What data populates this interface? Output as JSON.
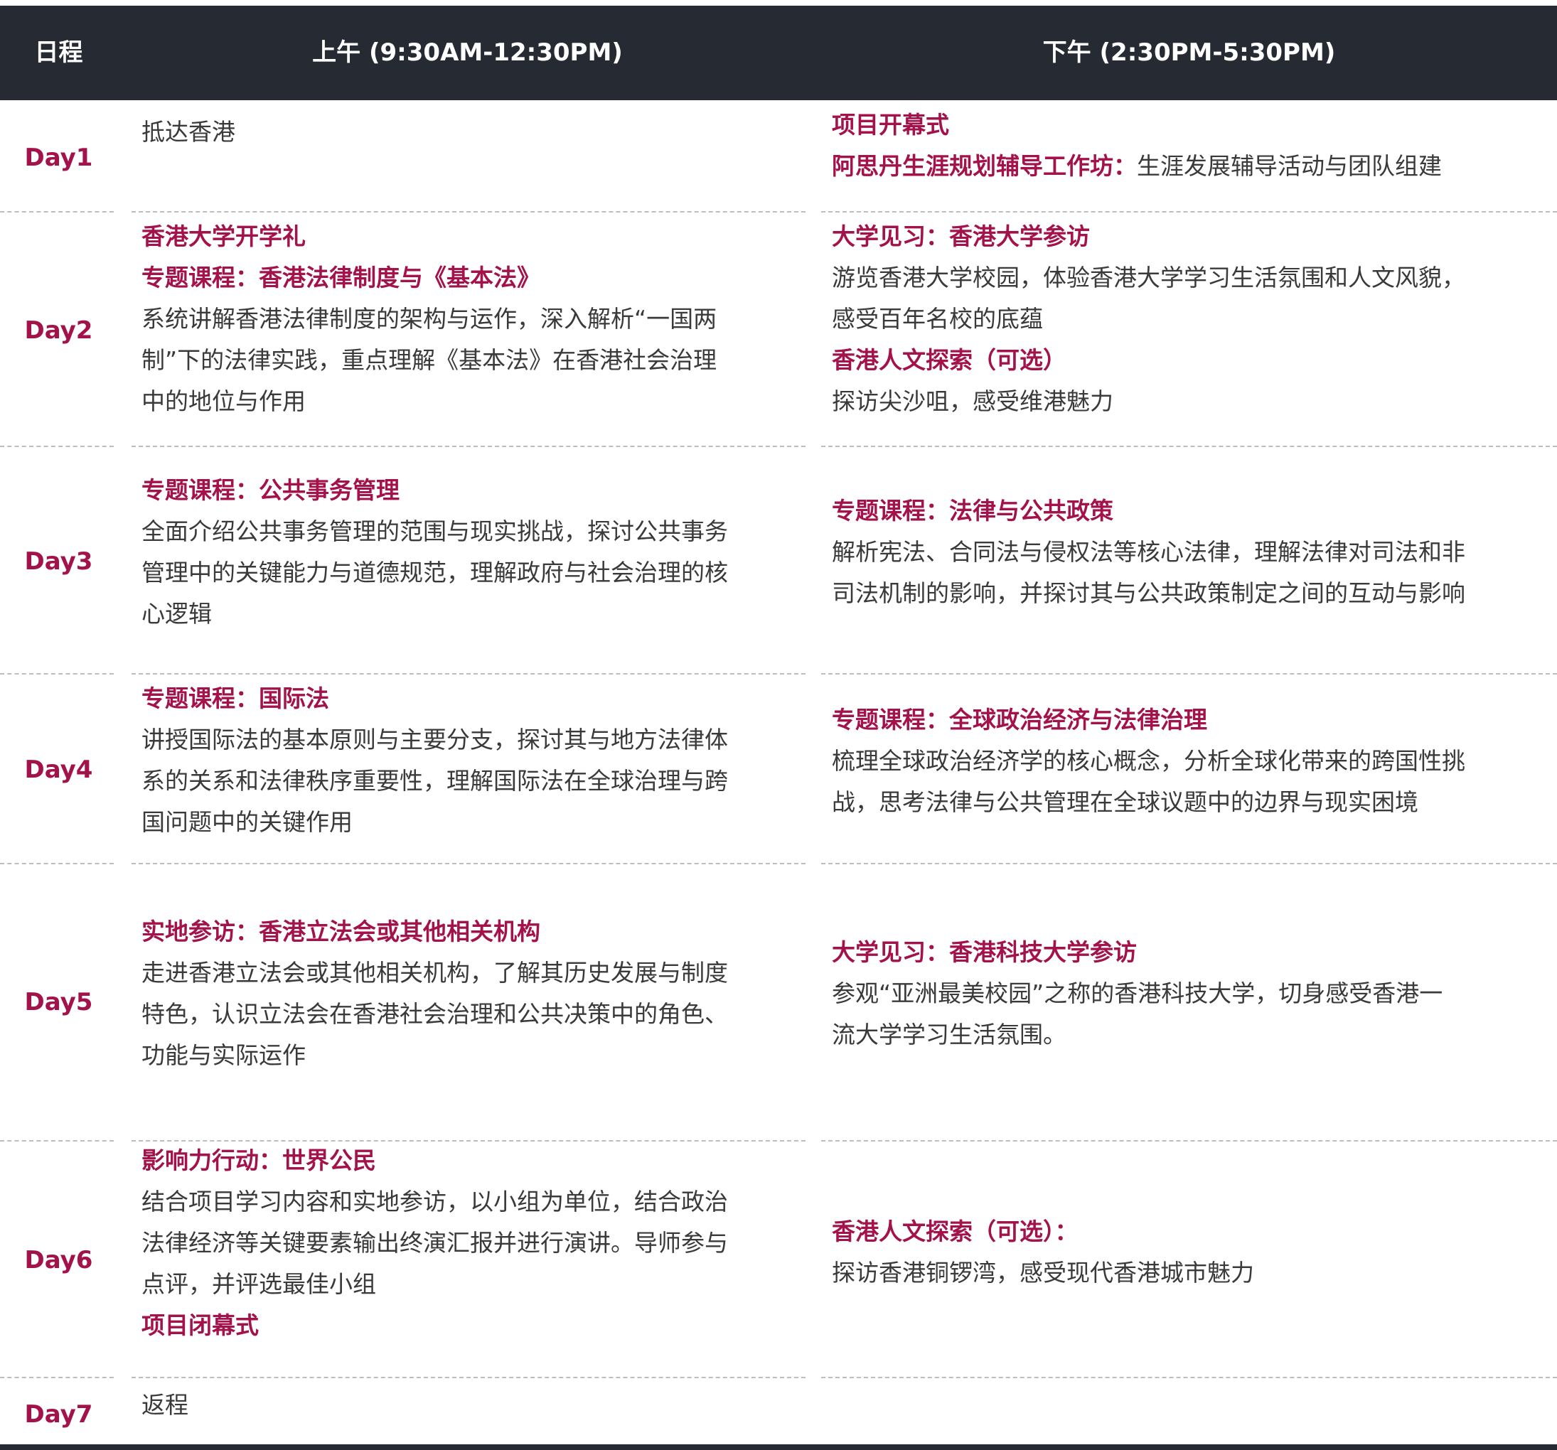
{
  "header": {
    "day": "日程",
    "am": "上午 (9:30AM-12:30PM)",
    "pm": "下午 (2:30PM-5:30PM)"
  },
  "days": [
    {
      "label": "Day1",
      "am": [
        {
          "t": "抵达香港",
          "h": false
        }
      ],
      "pm": [
        {
          "t": "项目开幕式",
          "h": true
        },
        {
          "t": "阿思丹生涯规划辅导工作坊：",
          "h": true,
          "rest": "生涯发展辅导活动与团队组建"
        }
      ]
    },
    {
      "label": "Day2",
      "am": [
        {
          "t": "香港大学开学礼",
          "h": true
        },
        {
          "t": "专题课程：香港法律制度与《基本法》",
          "h": true
        },
        {
          "t": "系统讲解香港法律制度的架构与运作，深入解析“一国两",
          "h": false
        },
        {
          "t": "制”下的法律实践，重点理解《基本法》在香港社会治理",
          "h": false
        },
        {
          "t": "中的地位与作用",
          "h": false
        }
      ],
      "pm": [
        {
          "t": "大学见习：香港大学参访",
          "h": true
        },
        {
          "t": "游览香港大学校园，体验香港大学学习生活氛围和人文风貌，",
          "h": false
        },
        {
          "t": "感受百年名校的底蕴",
          "h": false
        },
        {
          "t": "香港人文探索（可选）",
          "h": true
        },
        {
          "t": "探访尖沙咀，感受维港魅力",
          "h": false
        }
      ]
    },
    {
      "label": "Day3",
      "am": [
        {
          "t": "专题课程：公共事务管理",
          "h": true
        },
        {
          "t": "全面介绍公共事务管理的范围与现实挑战，探讨公共事务",
          "h": false
        },
        {
          "t": "管理中的关键能力与道德规范，理解政府与社会治理的核",
          "h": false
        },
        {
          "t": "心逻辑",
          "h": false
        }
      ],
      "pm": [
        {
          "t": "专题课程：法律与公共政策",
          "h": true
        },
        {
          "t": "解析宪法、合同法与侵权法等核心法律，理解法律对司法和非",
          "h": false
        },
        {
          "t": "司法机制的影响，并探讨其与公共政策制定之间的互动与影响",
          "h": false
        }
      ]
    },
    {
      "label": "Day4",
      "am": [
        {
          "t": "专题课程：国际法",
          "h": true
        },
        {
          "t": "讲授国际法的基本原则与主要分支，探讨其与地方法律体",
          "h": false
        },
        {
          "t": "系的关系和法律秩序重要性，理解国际法在全球治理与跨",
          "h": false
        },
        {
          "t": "国问题中的关键作用",
          "h": false
        }
      ],
      "pm": [
        {
          "t": "专题课程：全球政治经济与法律治理",
          "h": true
        },
        {
          "t": "梳理全球政治经济学的核心概念，分析全球化带来的跨国性挑",
          "h": false
        },
        {
          "t": "战，思考法律与公共管理在全球议题中的边界与现实困境",
          "h": false
        }
      ]
    },
    {
      "label": "Day5",
      "am": [
        {
          "t": "实地参访：香港立法会或其他相关机构",
          "h": true
        },
        {
          "t": "走进香港立法会或其他相关机构，了解其历史发展与制度",
          "h": false
        },
        {
          "t": "特色，认识立法会在香港社会治理和公共决策中的角色、",
          "h": false
        },
        {
          "t": "功能与实际运作",
          "h": false
        }
      ],
      "pm": [
        {
          "t": "大学见习：香港科技大学参访",
          "h": true
        },
        {
          "t": "参观“亚洲最美校园”之称的香港科技大学，切身感受香港一",
          "h": false
        },
        {
          "t": "流大学学习生活氛围。",
          "h": false
        }
      ]
    },
    {
      "label": "Day6",
      "am": [
        {
          "t": "影响力行动：世界公民",
          "h": true
        },
        {
          "t": "结合项目学习内容和实地参访，以小组为单位，结合政治",
          "h": false
        },
        {
          "t": "法律经济等关键要素输出终演汇报并进行演讲。导师参与",
          "h": false
        },
        {
          "t": "点评，并评选最佳小组",
          "h": false
        },
        {
          "t": "项目闭幕式",
          "h": true
        }
      ],
      "pm": [
        {
          "t": "香港人文探索（可选）：",
          "h": true
        },
        {
          "t": "探访香港铜锣湾，感受现代香港城市魅力",
          "h": false
        }
      ]
    },
    {
      "label": "Day7",
      "am": [
        {
          "t": "返程",
          "h": false
        }
      ],
      "pm": []
    }
  ]
}
